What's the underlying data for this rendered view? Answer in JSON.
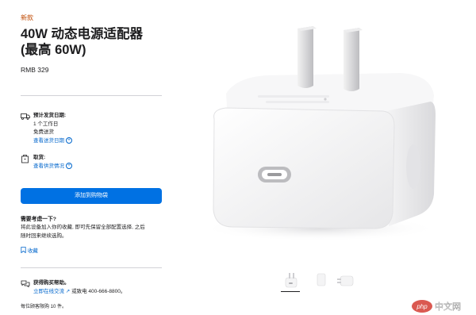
{
  "product": {
    "new_label": "新款",
    "title_line1": "40W 动态电源适配器",
    "title_line2": "(最高 60W)",
    "price": "RMB 329"
  },
  "delivery": {
    "heading": "预计发货日期:",
    "eta": "1 个工作日",
    "shipping": "免费送货",
    "link": "查看送货日期"
  },
  "pickup": {
    "heading": "取货:",
    "link": "查看供货情况"
  },
  "cart": {
    "button_label": "添加到购物袋"
  },
  "consider": {
    "title": "需要考虑一下?",
    "body_line1": "将此设备加入你的收藏, 即可先保留全部配置选择, 之后",
    "body_line2": "随时回来继续选购。",
    "save_label": "收藏"
  },
  "help": {
    "heading": "获得购买帮助。",
    "chat_link": "立即在线交流",
    "phone_text": "或致电 400-666-8800。"
  },
  "footnote": "每位顾客限购 10 件。",
  "watermark": {
    "text": "php中文网"
  },
  "gallery": {
    "thumbnail_count": 3,
    "selected_index": 0
  }
}
